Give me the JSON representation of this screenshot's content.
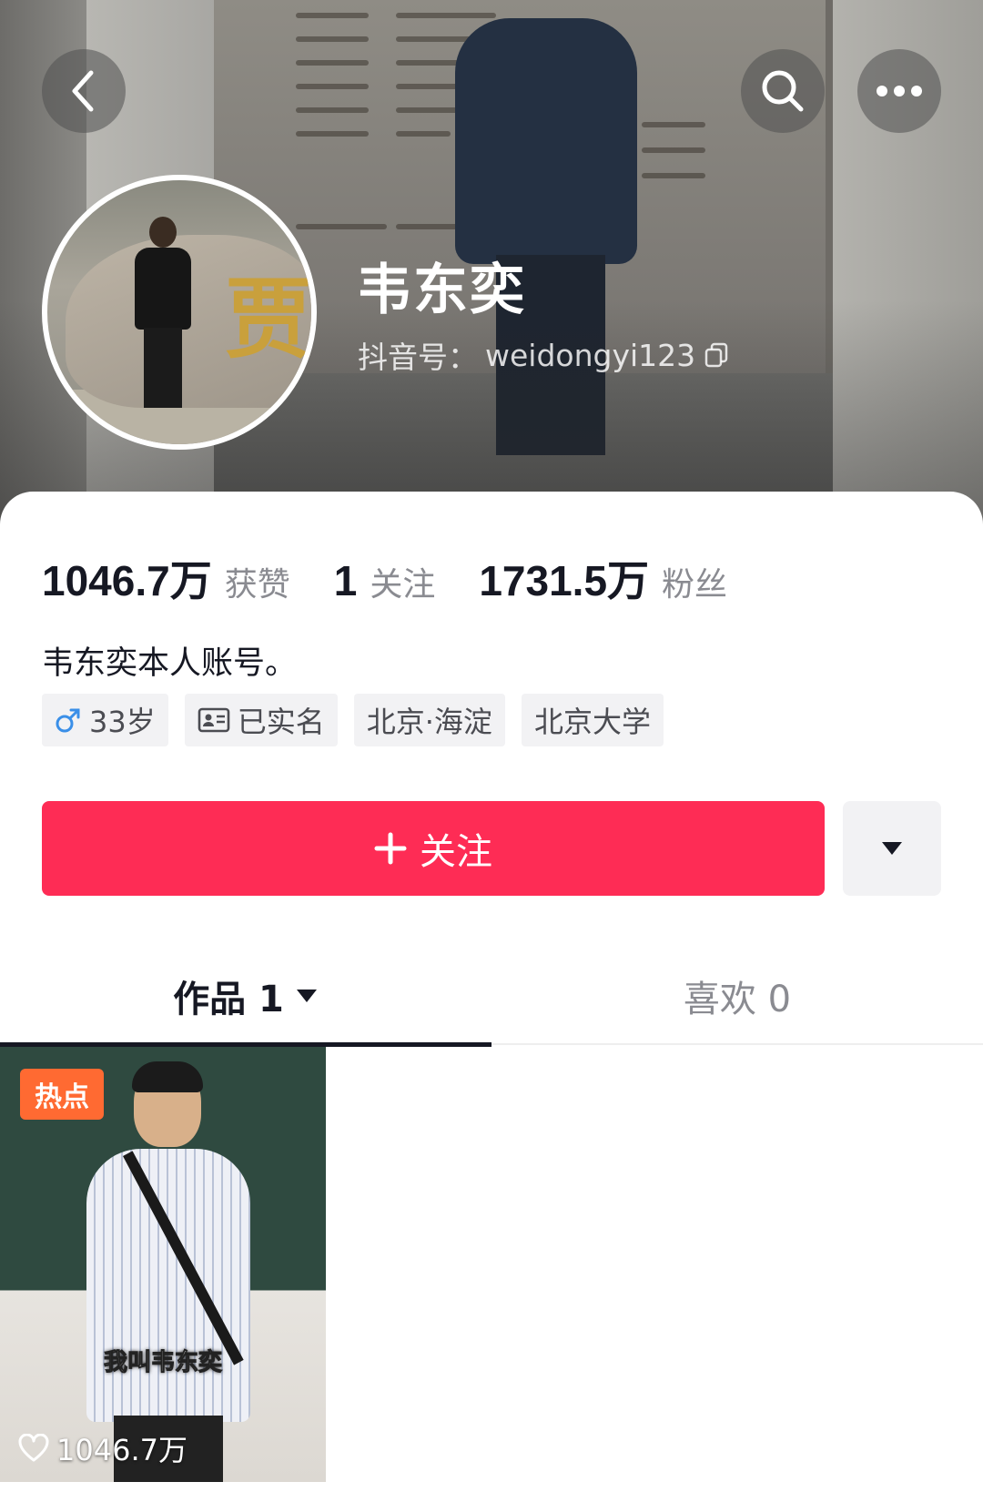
{
  "header": {
    "back_icon": "chevron-left-icon",
    "search_icon": "search-icon",
    "more_icon": "ellipsis-icon"
  },
  "profile": {
    "name": "韦东奕",
    "douyin_id_label": "抖音号：",
    "douyin_id": "weidongyi123",
    "copy_icon": "copy-icon",
    "avatar_glyph": "贾"
  },
  "stats": [
    {
      "value": "1046.7万",
      "label": "获赞"
    },
    {
      "value": "1",
      "label": "关注"
    },
    {
      "value": "1731.5万",
      "label": "粉丝"
    }
  ],
  "bio": "韦东奕本人账号。",
  "tags": [
    {
      "icon": "male-icon",
      "text": "33岁"
    },
    {
      "icon": "id-card-icon",
      "text": "已实名"
    },
    {
      "icon": "",
      "text": "北京·海淀"
    },
    {
      "icon": "",
      "text": "北京大学"
    }
  ],
  "actions": {
    "follow_label": "关注",
    "follow_icon": "plus-icon",
    "more_icon": "caret-down-icon"
  },
  "tabs": [
    {
      "label": "作品 1",
      "active": true
    },
    {
      "label": "喜欢 0",
      "active": false
    }
  ],
  "videos": [
    {
      "badge": "热点",
      "caption": "我叫韦东奕",
      "likes": "1046.7万"
    }
  ],
  "colors": {
    "accent": "#fe2c55",
    "hot_badge": "#ff6a32",
    "text_primary": "#161823",
    "text_secondary": "#8a8b91",
    "tag_bg": "#f2f2f4"
  }
}
